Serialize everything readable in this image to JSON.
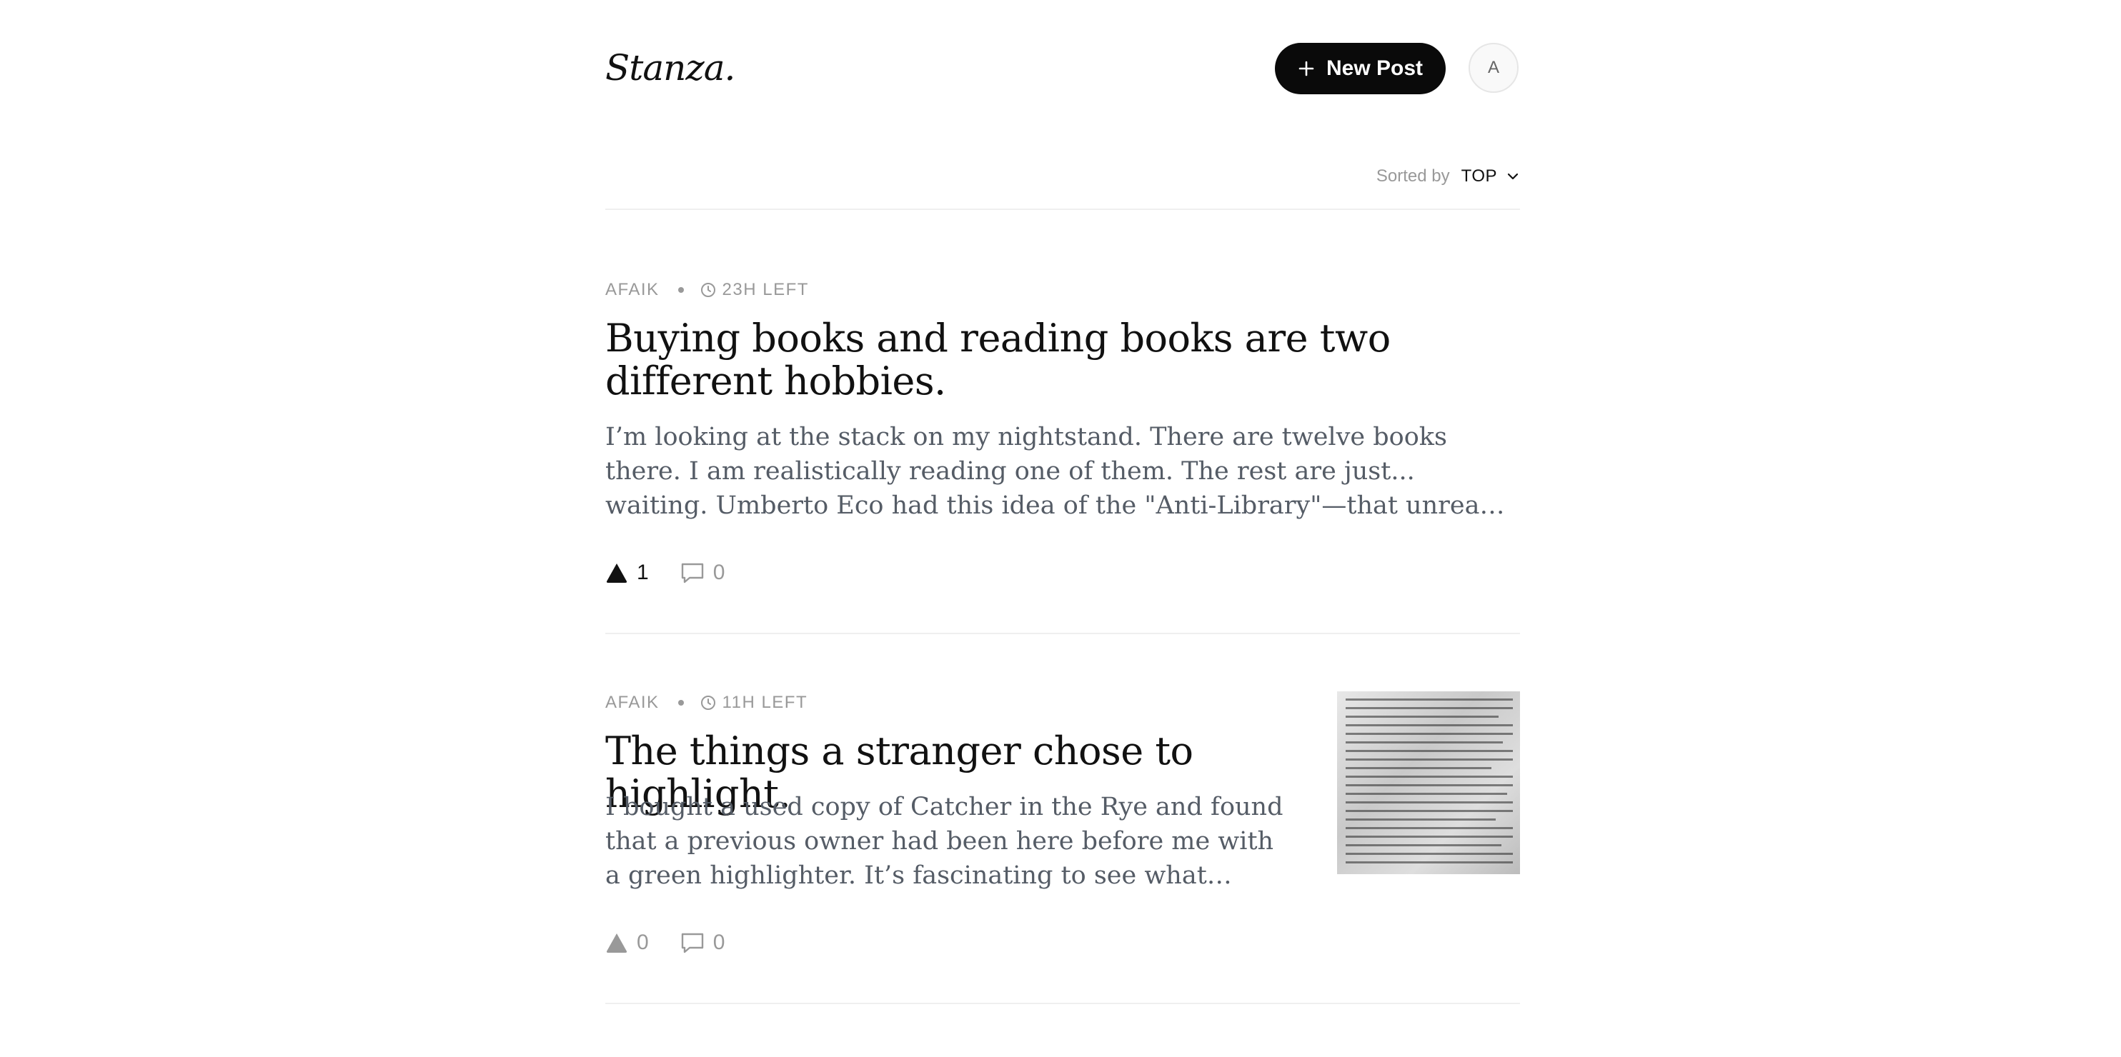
{
  "header": {
    "logo": "Stanza.",
    "new_post_label": "New Post",
    "avatar_initial": "A"
  },
  "sort": {
    "label": "Sorted by",
    "value": "TOP"
  },
  "posts": [
    {
      "author": "AFAIK",
      "time_left": "23H LEFT",
      "title": "Buying books and reading books are two different hobbies.",
      "excerpt": "I’m looking at the stack on my nightstand. There are twelve books there. I am realistically reading one of them. The rest are just... waiting. Umberto Eco had this idea of the \"Anti-Library\"—that unread books are actually more valuable than read ones.",
      "upvotes": "1",
      "comments": "0",
      "upvoted": true,
      "has_thumbnail": false
    },
    {
      "author": "AFAIK",
      "time_left": "11H LEFT",
      "title": "The things a stranger chose to highlight.",
      "excerpt": "I bought a used copy of Catcher in the Rye and found that a previous owner had been here before me with a green highlighter. It’s fascinating to see what resonated with them. Some of it makes sense.",
      "upvotes": "0",
      "comments": "0",
      "upvoted": false,
      "has_thumbnail": true
    }
  ],
  "colors": {
    "accent": "#0a0a0a",
    "muted": "#999999",
    "excerpt": "#555c66",
    "divider": "#efefef"
  }
}
